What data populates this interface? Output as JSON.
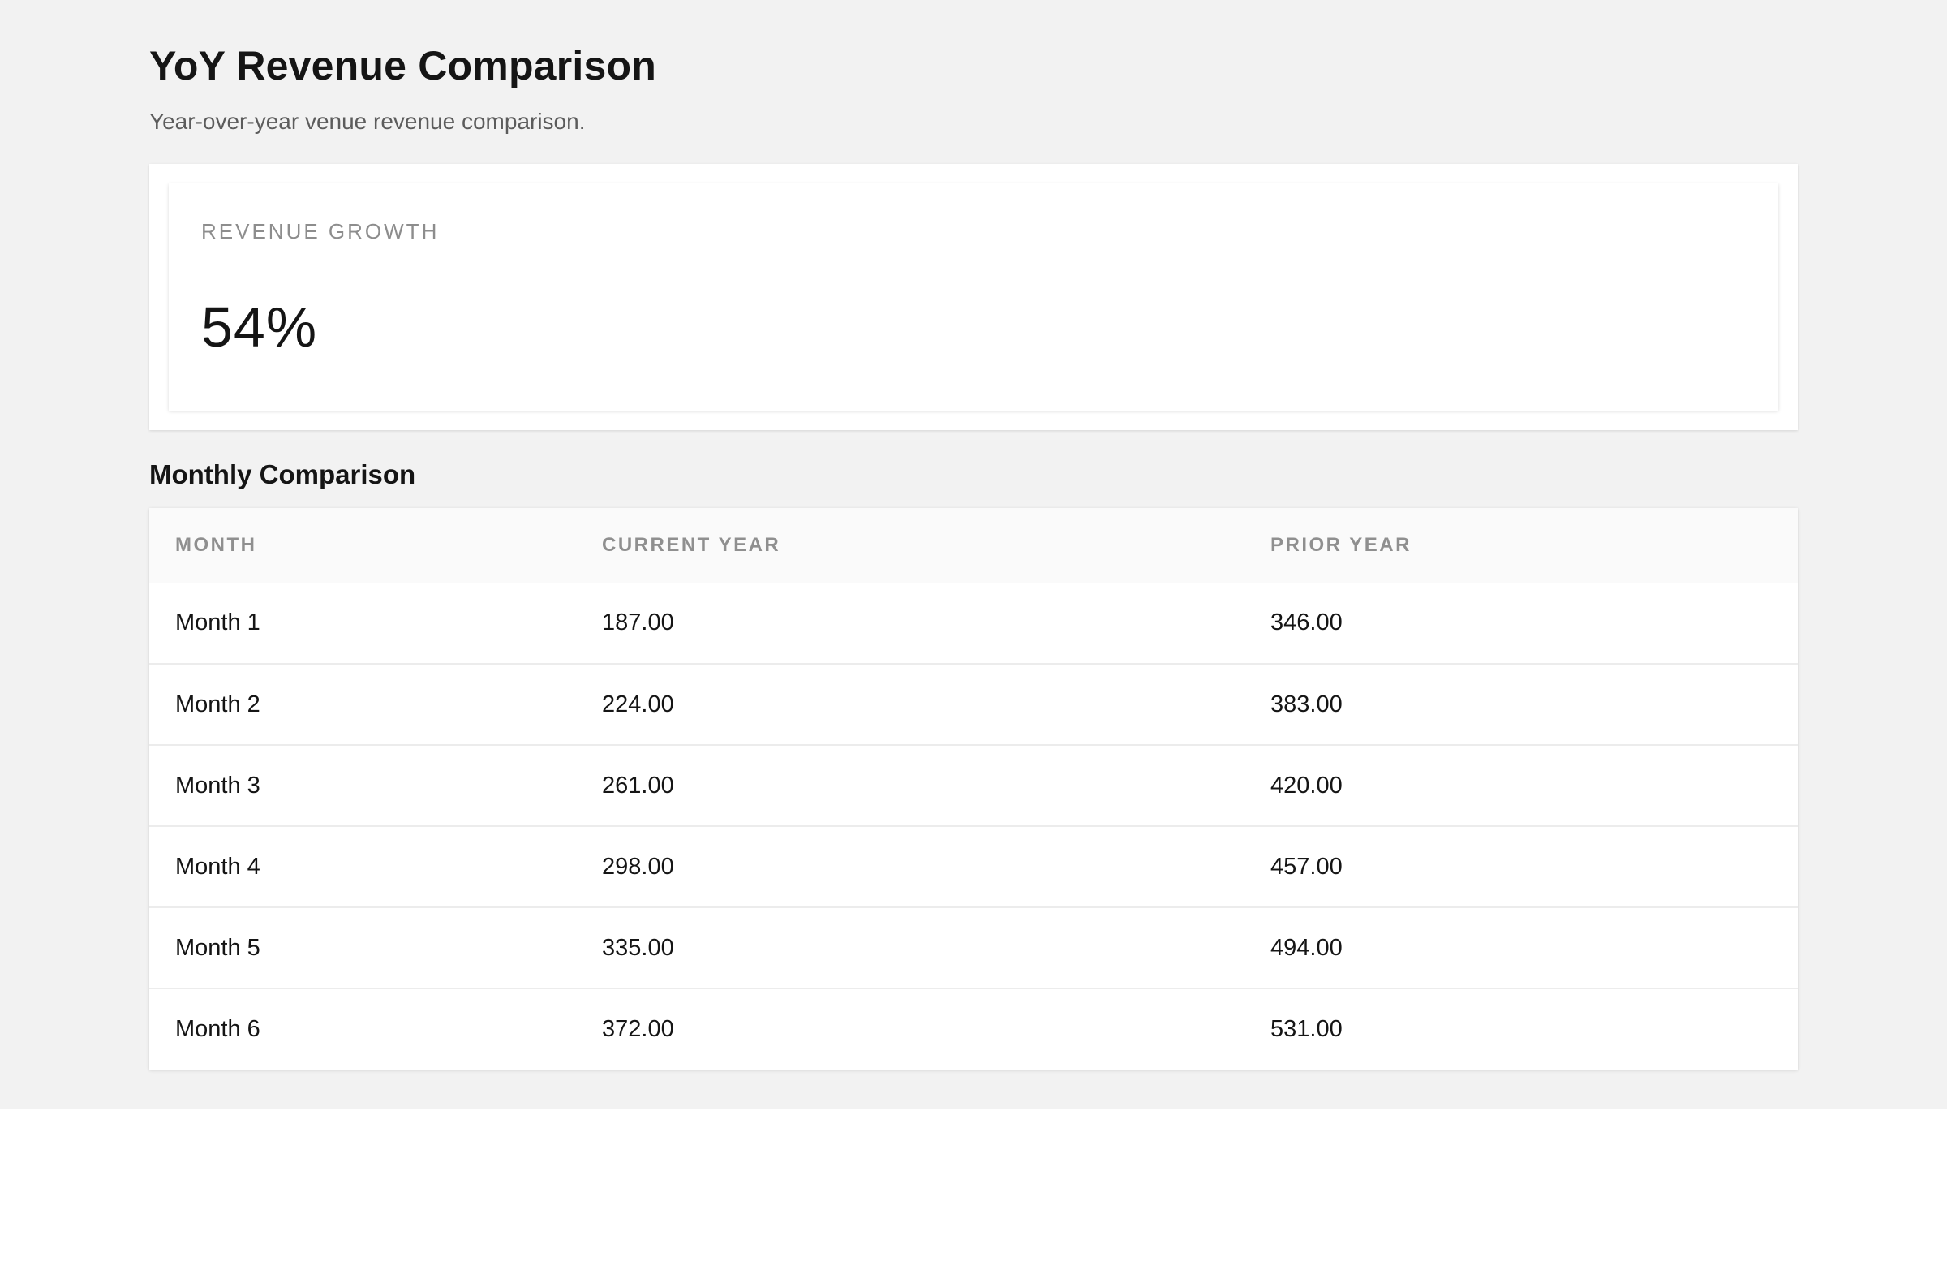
{
  "header": {
    "title": "YoY Revenue Comparison",
    "subtitle": "Year-over-year venue revenue comparison."
  },
  "metric": {
    "label": "REVENUE GROWTH",
    "value": "54%"
  },
  "table": {
    "title": "Monthly Comparison",
    "columns": [
      "MONTH",
      "CURRENT YEAR",
      "PRIOR YEAR"
    ],
    "rows": [
      [
        "Month 1",
        "187.00",
        "346.00"
      ],
      [
        "Month 2",
        "224.00",
        "383.00"
      ],
      [
        "Month 3",
        "261.00",
        "420.00"
      ],
      [
        "Month 4",
        "298.00",
        "457.00"
      ],
      [
        "Month 5",
        "335.00",
        "494.00"
      ],
      [
        "Month 6",
        "372.00",
        "531.00"
      ]
    ]
  },
  "colors": {
    "page_background": "#f2f2f2",
    "card_background": "#ffffff",
    "muted_text": "#8d8d8d",
    "primary_text": "#151515"
  }
}
